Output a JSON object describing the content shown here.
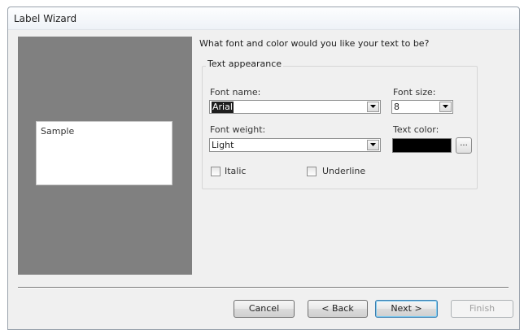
{
  "window": {
    "title": "Label Wizard"
  },
  "preview": {
    "sample_text": "Sample"
  },
  "prompt": "What font and color would you like your text to be?",
  "text_appearance": {
    "group_label": "Text appearance",
    "font_name_label": "Font name:",
    "font_name_value": "Arial",
    "font_size_label": "Font size:",
    "font_size_value": "8",
    "font_weight_label": "Font weight:",
    "font_weight_value": "Light",
    "text_color_label": "Text color:",
    "text_color_value": "#000000",
    "ellipsis_label": "...",
    "italic_label": "Italic",
    "italic_checked": false,
    "underline_label": "Underline",
    "underline_checked": false
  },
  "buttons": {
    "cancel": "Cancel",
    "back": "< Back",
    "next": "Next >",
    "finish": "Finish"
  },
  "icons": {
    "dropdown": "chevron-down-icon"
  }
}
